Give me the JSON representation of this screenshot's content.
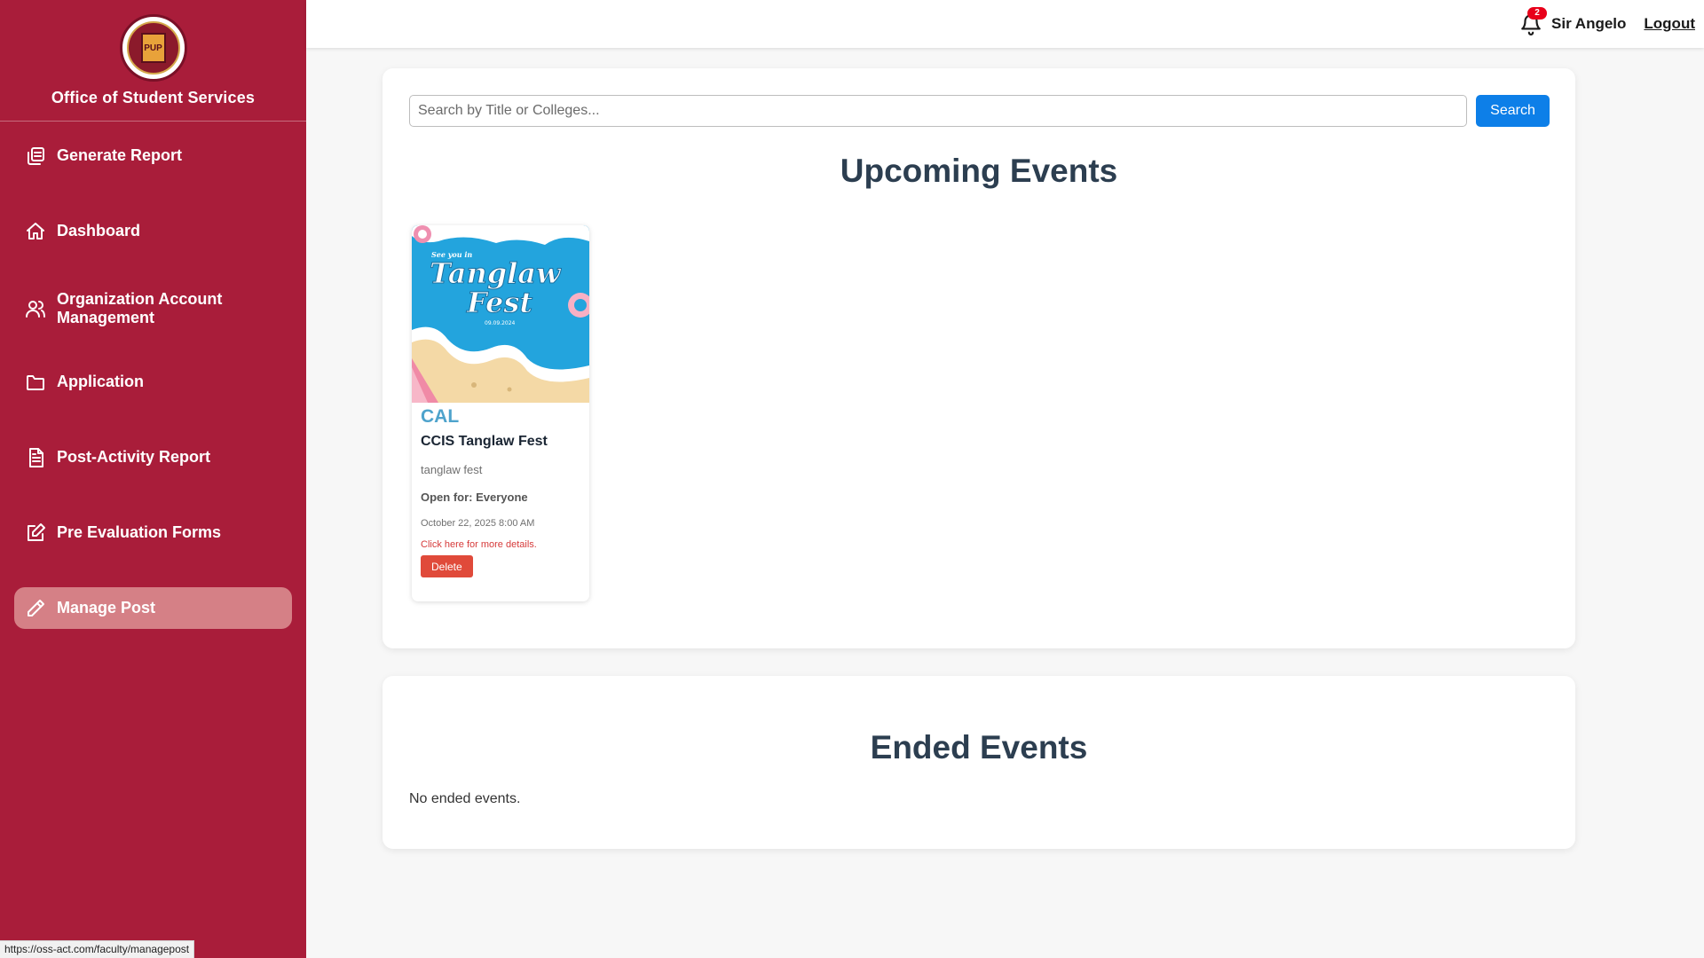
{
  "sidebar": {
    "org_title": "Office of Student Services",
    "logo_text": "PUP",
    "items": [
      {
        "label": "Generate Report",
        "icon": "report-icon"
      },
      {
        "label": "Dashboard",
        "icon": "home-icon"
      },
      {
        "label": "Organization Account Management",
        "icon": "users-icon"
      },
      {
        "label": "Application",
        "icon": "folder-icon"
      },
      {
        "label": "Post-Activity Report",
        "icon": "document-icon"
      },
      {
        "label": "Pre Evaluation Forms",
        "icon": "edit-form-icon"
      },
      {
        "label": "Manage Post",
        "icon": "pencil-icon",
        "active": true
      }
    ]
  },
  "topbar": {
    "notification_count": "2",
    "user_name": "Sir Angelo",
    "logout_label": "Logout"
  },
  "search": {
    "placeholder": "Search by Title or Colleges...",
    "value": "",
    "button_label": "Search"
  },
  "upcoming": {
    "title": "Upcoming Events",
    "events": [
      {
        "poster_line1": "See you in",
        "poster_line2": "Tanglaw",
        "poster_line3": "Fest",
        "poster_date": "09.09.2024",
        "college": "CAL",
        "title": "CCIS Tanglaw Fest",
        "description": "tanglaw fest",
        "open_for": "Open for: Everyone",
        "date": "October 22, 2025 8:00 AM",
        "details_link": "Click here for more details.",
        "delete_label": "Delete"
      }
    ]
  },
  "ended": {
    "title": "Ended Events",
    "empty_message": "No ended events."
  },
  "statusbar": {
    "url": "https://oss-act.com/faculty/managepost"
  },
  "colors": {
    "sidebar_bg": "#a91d3a",
    "active_item_bg": "#d58086",
    "search_button": "#0d7fe8",
    "delete_button": "#e04a3a",
    "college_text": "#4ea3cc",
    "badge": "#e8001a"
  }
}
